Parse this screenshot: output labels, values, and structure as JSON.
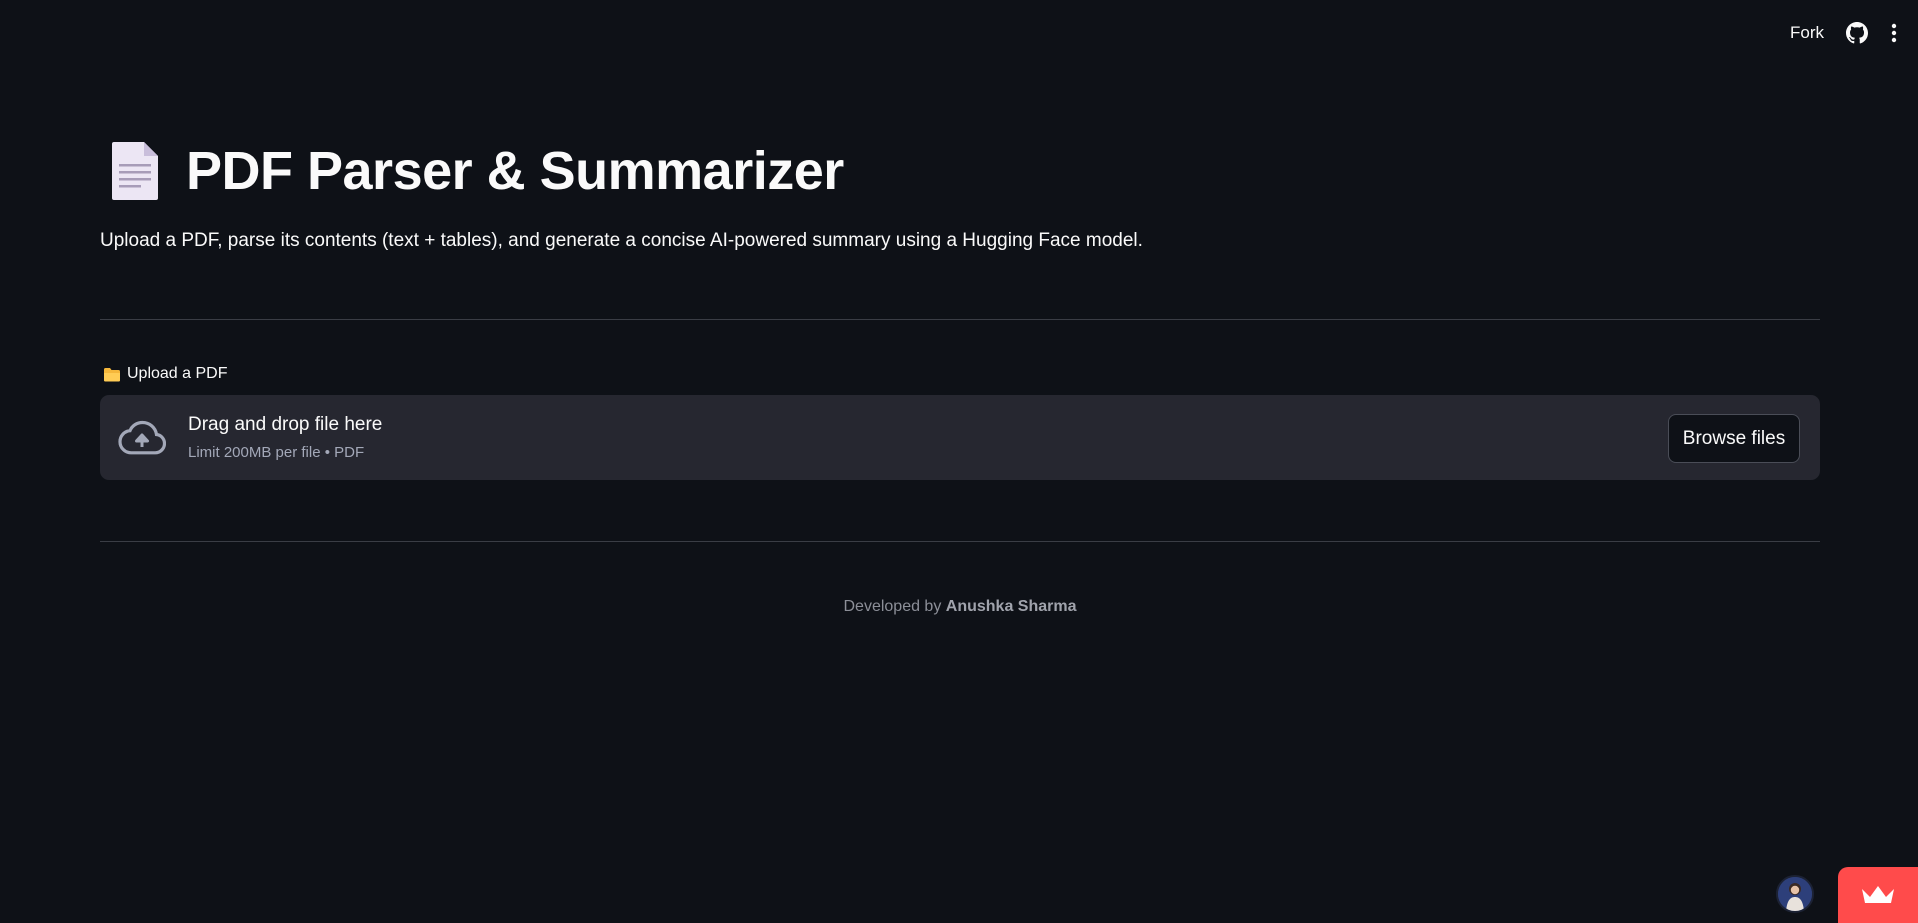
{
  "topbar": {
    "fork_label": "Fork",
    "icons": [
      "github-icon",
      "more-vertical-icon"
    ]
  },
  "header": {
    "title": "PDF Parser & Summarizer",
    "title_icon": "document-icon",
    "subtitle": "Upload a PDF, parse its contents (text + tables), and generate a concise AI-powered summary using a Hugging Face model."
  },
  "uploader": {
    "label": "Upload a PDF",
    "label_icon": "folder-icon",
    "drop_title": "Drag and drop file here",
    "drop_limit": "Limit 200MB per file • PDF",
    "browse_label": "Browse files",
    "icon": "cloud-upload-icon"
  },
  "footer": {
    "prefix": "Developed by",
    "author": "Anushka Sharma"
  },
  "colors": {
    "background": "#0e1117",
    "dropzone": "#262730",
    "accent": "#ff4b4b"
  }
}
